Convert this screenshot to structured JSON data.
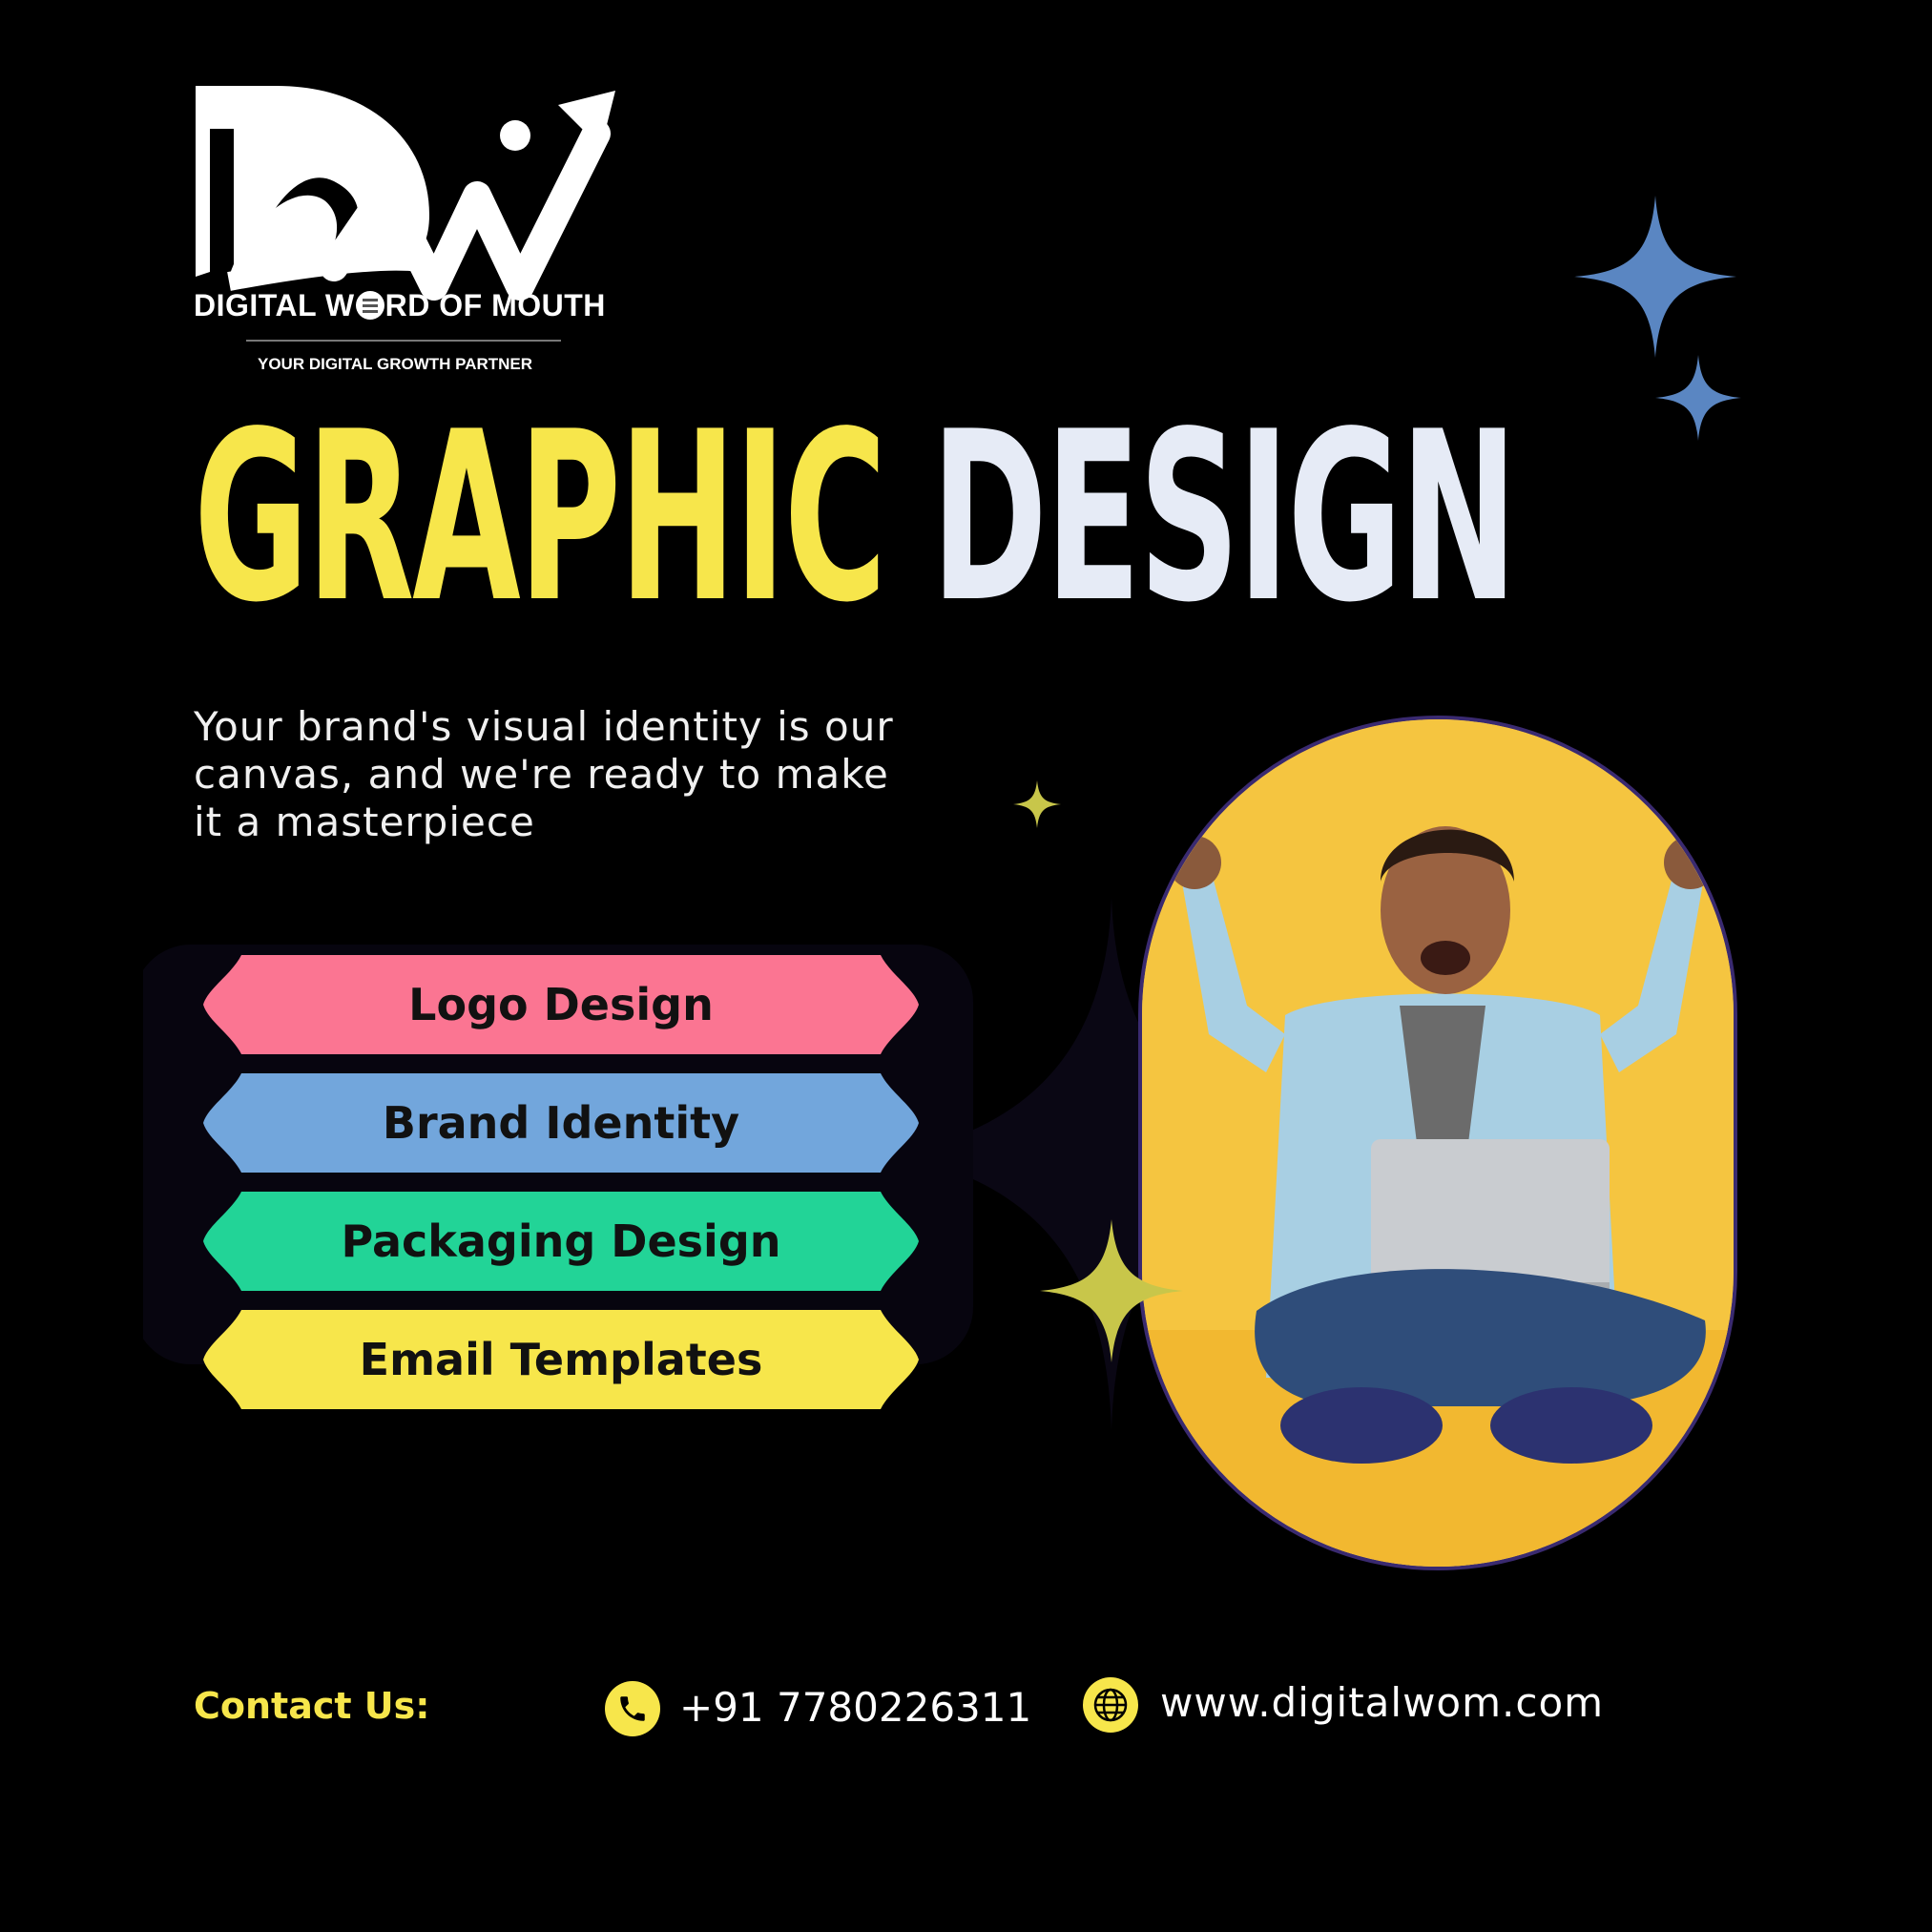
{
  "brand": {
    "name_prefix": "DIGITAL W",
    "name_suffix": "RD OF MOUTH",
    "tagline": "YOUR DIGITAL GROWTH PARTNER"
  },
  "headline": {
    "part1": "GRAPHIC",
    "part2": "DESIGN"
  },
  "subtitle": "Your brand's visual identity is our canvas, and we're ready to make it a masterpiece",
  "services": [
    {
      "label": "Logo Design",
      "color": "#fb7592"
    },
    {
      "label": "Brand Identity",
      "color": "#72a6dc"
    },
    {
      "label": "Packaging Design",
      "color": "#22d497"
    },
    {
      "label": "Email Templates",
      "color": "#f7e64b"
    }
  ],
  "contact": {
    "label": "Contact Us:",
    "phone": "+91 7780226311",
    "website": "www.digitalwom.com"
  },
  "colors": {
    "background": "#000000",
    "accent_yellow": "#f7e64b",
    "star_blue": "#5a86c2",
    "star_olive": "#c8c64a"
  },
  "icons": [
    "sparkle-icon",
    "phone-icon",
    "globe-icon"
  ]
}
